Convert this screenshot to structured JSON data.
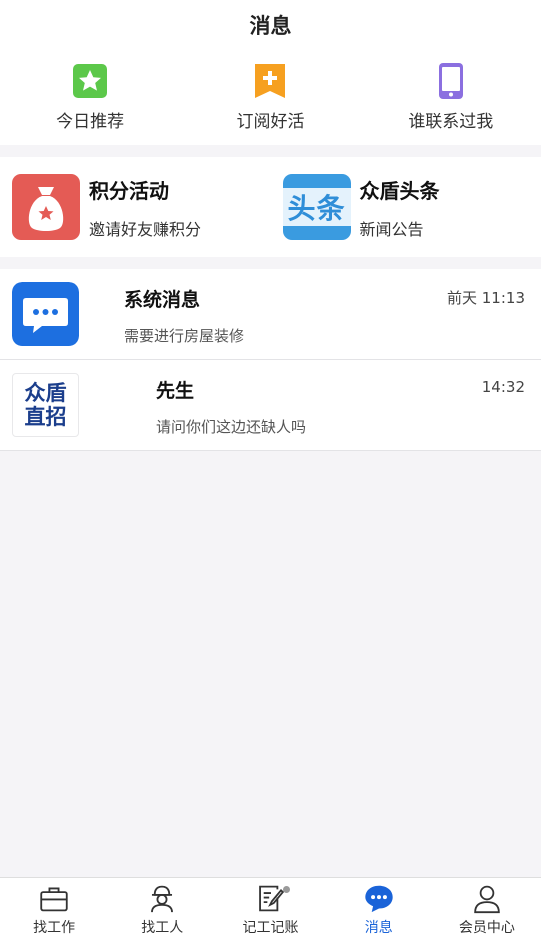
{
  "header": {
    "title": "消息"
  },
  "quick_links": [
    {
      "label": "今日推荐",
      "icon": "star-icon",
      "color": "#5cc84a"
    },
    {
      "label": "订阅好活",
      "icon": "bookmark-plus-icon",
      "color": "#f6a020"
    },
    {
      "label": "谁联系过我",
      "icon": "phone-icon",
      "color": "#8b6fe0"
    }
  ],
  "cards": [
    {
      "title": "积分活动",
      "subtitle": "邀请好友赚积分",
      "icon": "money-bag-icon",
      "color": "#e45b55"
    },
    {
      "title": "众盾头条",
      "subtitle": "新闻公告",
      "icon": "headline-icon",
      "icon_text": "头条",
      "color": "#3a9be0"
    }
  ],
  "messages": [
    {
      "name": "系统消息",
      "preview": "需要进行房屋装修",
      "time": "前天 11:13",
      "icon": "chat-bubble-icon",
      "color": "#1d6fe0"
    },
    {
      "name": "先生",
      "preview": "请问你们这边还缺人吗",
      "time": "14:32",
      "icon": "logo-avatar",
      "logo_line1": "众盾",
      "logo_line2": "直招",
      "color": "#1b3e8c"
    }
  ],
  "tabbar": [
    {
      "label": "找工作",
      "icon": "briefcase-icon",
      "active": false
    },
    {
      "label": "找工人",
      "icon": "worker-icon",
      "active": false
    },
    {
      "label": "记工记账",
      "icon": "edit-note-icon",
      "active": false,
      "dot": true
    },
    {
      "label": "消息",
      "icon": "message-icon",
      "active": true
    },
    {
      "label": "会员中心",
      "icon": "user-icon",
      "active": false
    }
  ],
  "colors": {
    "accent": "#1a63d8",
    "background": "#f5f4f7"
  }
}
